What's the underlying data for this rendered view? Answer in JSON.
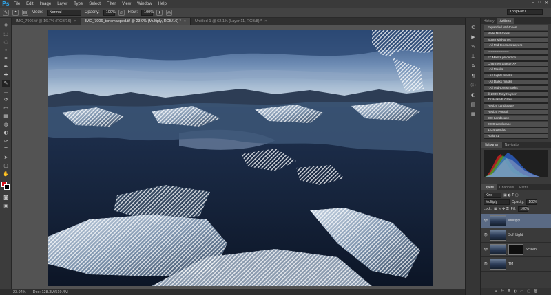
{
  "app": {
    "logo": "Ps",
    "menu": [
      "File",
      "Edit",
      "Image",
      "Layer",
      "Type",
      "Select",
      "Filter",
      "View",
      "Window",
      "Help"
    ],
    "window_controls": [
      "–",
      "□",
      "✕"
    ]
  },
  "options": {
    "mode_label": "Mode:",
    "mode_value": "Normal",
    "opacity_label": "Opacity:",
    "opacity_value": "100%",
    "flow_label": "Flow:",
    "flow_value": "100%",
    "workspace": "TonyFav1"
  },
  "tabs": [
    {
      "label": "IMG_7906.tif @ 16.7% (RGB/16)",
      "active": false
    },
    {
      "label": "IMG_7906_tonemapped.tif @ 23.9% (Multiply, RGB/16) *",
      "active": true
    },
    {
      "label": "Untitled-1 @ 62.1% (Layer 11, RGB/8) *",
      "active": false
    }
  ],
  "status": {
    "zoom": "23.94%",
    "doc": "Doc: 128.3M/519.4M"
  },
  "panels": {
    "history_tabs": [
      "History",
      "Actions"
    ],
    "actions": [
      "Expanded Mid-tones",
      "Wide Mid-tones",
      "Super Mid-tones",
      "- All Mid-tones as Layers",
      "--------------------",
      "<< Masks placed on",
      "Channels palette >>",
      "- All Masks",
      "- All Lights masks",
      "- All Darks masks",
      "- All Mid-tones masks",
      "© 2009 Tony Kuyper",
      "TK-Make B Glow",
      "Resize Landscape",
      "Resize Portrait",
      "800 Landscape",
      "2000 Landscape",
      "1224 Landsc",
      "Action 1"
    ],
    "histogram_tabs": [
      "Histogram",
      "Navigator"
    ],
    "layers_tabs": [
      "Layers",
      "Channels",
      "Paths"
    ],
    "kind_label": "Kind",
    "blend_mode": "Multiply",
    "opacity_label": "Opacity:",
    "opacity_value": "100%",
    "lock_label": "Lock:",
    "fill_label": "Fill:",
    "fill_value": "100%",
    "layers": [
      {
        "name": "Multiply",
        "selected": true,
        "mask": false
      },
      {
        "name": "Soft Light",
        "selected": false,
        "mask": false
      },
      {
        "name": "Screen",
        "selected": false,
        "mask": true
      },
      {
        "name": "TM",
        "selected": false,
        "mask": false
      }
    ]
  },
  "colors": {
    "foreground": "#d6101a",
    "background": "#000000",
    "selected_layer": "#5a6a84"
  }
}
